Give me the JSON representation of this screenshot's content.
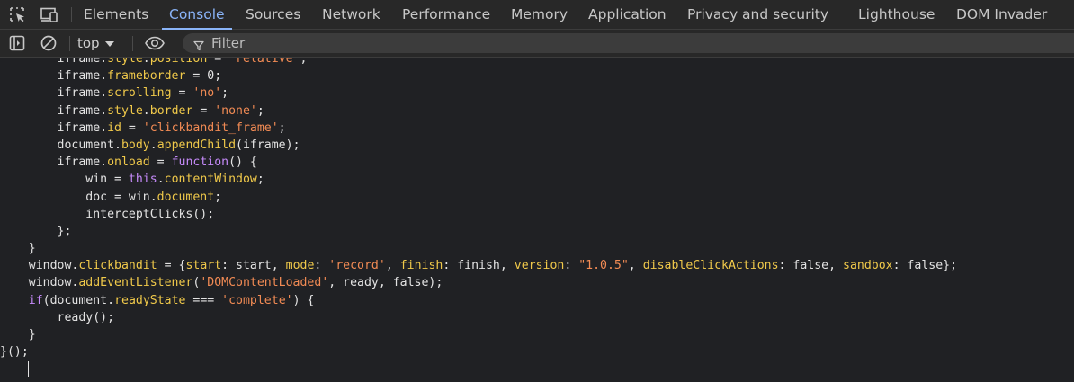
{
  "tabs": [
    {
      "label": "Elements",
      "active": false
    },
    {
      "label": "Console",
      "active": true
    },
    {
      "label": "Sources",
      "active": false
    },
    {
      "label": "Network",
      "active": false
    },
    {
      "label": "Performance",
      "active": false
    },
    {
      "label": "Memory",
      "active": false
    },
    {
      "label": "Application",
      "active": false
    },
    {
      "label": "Privacy and security",
      "active": false
    },
    {
      "label": "Lighthouse",
      "active": false
    },
    {
      "label": "DOM Invader",
      "active": false
    }
  ],
  "toolbar_icons": {
    "inspect": "inspect-element-icon",
    "device": "device-toolbar-icon",
    "sidebar": "show-sidebar-icon",
    "clear": "clear-console-icon",
    "eye": "live-expression-eye-icon",
    "filter": "filter-icon"
  },
  "toolbar": {
    "context": "top",
    "filter_placeholder": "Filter"
  },
  "colors": {
    "background": "#202124",
    "panel": "#282828",
    "accent": "#8ab4f8",
    "property": "#f0c94a",
    "string": "#f28b54",
    "keyword": "#c58af9",
    "text": "#e3e3e3"
  },
  "code_lines": [
    [
      {
        "t": "        iframe.",
        "k": "plain"
      },
      {
        "t": "style",
        "k": "prop"
      },
      {
        "t": ".",
        "k": "plain"
      },
      {
        "t": "position",
        "k": "prop"
      },
      {
        "t": " = ",
        "k": "plain"
      },
      {
        "t": "'relative'",
        "k": "str"
      },
      {
        "t": ";",
        "k": "plain"
      }
    ],
    [
      {
        "t": "        iframe.",
        "k": "plain"
      },
      {
        "t": "frameborder",
        "k": "prop"
      },
      {
        "t": " = 0;",
        "k": "plain"
      }
    ],
    [
      {
        "t": "        iframe.",
        "k": "plain"
      },
      {
        "t": "scrolling",
        "k": "prop"
      },
      {
        "t": " = ",
        "k": "plain"
      },
      {
        "t": "'no'",
        "k": "str"
      },
      {
        "t": ";",
        "k": "plain"
      }
    ],
    [
      {
        "t": "        iframe.",
        "k": "plain"
      },
      {
        "t": "style",
        "k": "prop"
      },
      {
        "t": ".",
        "k": "plain"
      },
      {
        "t": "border",
        "k": "prop"
      },
      {
        "t": " = ",
        "k": "plain"
      },
      {
        "t": "'none'",
        "k": "str"
      },
      {
        "t": ";",
        "k": "plain"
      }
    ],
    [
      {
        "t": "        iframe.",
        "k": "plain"
      },
      {
        "t": "id",
        "k": "prop"
      },
      {
        "t": " = ",
        "k": "plain"
      },
      {
        "t": "'clickbandit_frame'",
        "k": "str"
      },
      {
        "t": ";",
        "k": "plain"
      }
    ],
    [
      {
        "t": "        document.",
        "k": "plain"
      },
      {
        "t": "body",
        "k": "prop"
      },
      {
        "t": ".",
        "k": "plain"
      },
      {
        "t": "appendChild",
        "k": "prop"
      },
      {
        "t": "(iframe);",
        "k": "plain"
      }
    ],
    [
      {
        "t": "        iframe.",
        "k": "plain"
      },
      {
        "t": "onload",
        "k": "prop"
      },
      {
        "t": " = ",
        "k": "plain"
      },
      {
        "t": "function",
        "k": "kw"
      },
      {
        "t": "() {",
        "k": "plain"
      }
    ],
    [
      {
        "t": "            win = ",
        "k": "plain"
      },
      {
        "t": "this",
        "k": "kw"
      },
      {
        "t": ".",
        "k": "plain"
      },
      {
        "t": "contentWindow",
        "k": "prop"
      },
      {
        "t": ";",
        "k": "plain"
      }
    ],
    [
      {
        "t": "            doc = win.",
        "k": "plain"
      },
      {
        "t": "document",
        "k": "prop"
      },
      {
        "t": ";",
        "k": "plain"
      }
    ],
    [
      {
        "t": "            interceptClicks();",
        "k": "plain"
      }
    ],
    [
      {
        "t": "        };",
        "k": "plain"
      }
    ],
    [
      {
        "t": "    }",
        "k": "plain"
      }
    ],
    [
      {
        "t": "    window.",
        "k": "plain"
      },
      {
        "t": "clickbandit",
        "k": "prop"
      },
      {
        "t": " = {",
        "k": "plain"
      },
      {
        "t": "start",
        "k": "prop"
      },
      {
        "t": ": start, ",
        "k": "plain"
      },
      {
        "t": "mode",
        "k": "prop"
      },
      {
        "t": ": ",
        "k": "plain"
      },
      {
        "t": "'record'",
        "k": "str"
      },
      {
        "t": ", ",
        "k": "plain"
      },
      {
        "t": "finish",
        "k": "prop"
      },
      {
        "t": ": finish, ",
        "k": "plain"
      },
      {
        "t": "version",
        "k": "prop"
      },
      {
        "t": ": ",
        "k": "plain"
      },
      {
        "t": "\"1.0.5\"",
        "k": "str"
      },
      {
        "t": ", ",
        "k": "plain"
      },
      {
        "t": "disableClickActions",
        "k": "prop"
      },
      {
        "t": ": false, ",
        "k": "plain"
      },
      {
        "t": "sandbox",
        "k": "prop"
      },
      {
        "t": ": false};",
        "k": "plain"
      }
    ],
    [
      {
        "t": "    window.",
        "k": "plain"
      },
      {
        "t": "addEventListener",
        "k": "prop"
      },
      {
        "t": "(",
        "k": "plain"
      },
      {
        "t": "'DOMContentLoaded'",
        "k": "str"
      },
      {
        "t": ", ready, false);",
        "k": "plain"
      }
    ],
    [
      {
        "t": "    ",
        "k": "plain"
      },
      {
        "t": "if",
        "k": "kw"
      },
      {
        "t": "(document.",
        "k": "plain"
      },
      {
        "t": "readyState",
        "k": "prop"
      },
      {
        "t": " === ",
        "k": "plain"
      },
      {
        "t": "'complete'",
        "k": "str"
      },
      {
        "t": ") {",
        "k": "plain"
      }
    ],
    [
      {
        "t": "        ready();",
        "k": "plain"
      }
    ],
    [
      {
        "t": "    }",
        "k": "plain"
      }
    ],
    [
      {
        "t": "}();",
        "k": "plain"
      }
    ]
  ]
}
